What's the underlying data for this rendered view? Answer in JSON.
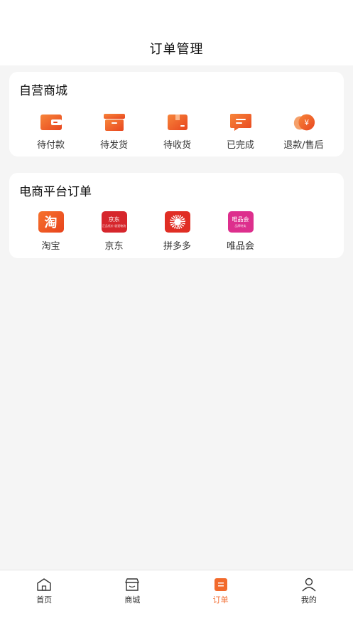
{
  "header": {
    "title": "订单管理"
  },
  "own_mall": {
    "title": "自营商城",
    "items": [
      {
        "label": "待付款",
        "icon": "wallet-icon"
      },
      {
        "label": "待发货",
        "icon": "box-icon"
      },
      {
        "label": "待收货",
        "icon": "package-icon"
      },
      {
        "label": "已完成",
        "icon": "message-icon"
      },
      {
        "label": "退款/售后",
        "icon": "refund-icon"
      }
    ]
  },
  "platform_orders": {
    "title": "电商平台订单",
    "items": [
      {
        "label": "淘宝",
        "logo_text": "淘"
      },
      {
        "label": "京东",
        "logo_text": "京东",
        "logo_sub": "正品低价 极速物流"
      },
      {
        "label": "拼多多"
      },
      {
        "label": "唯品会",
        "logo_text": "唯品会",
        "logo_sub": "品牌特卖"
      }
    ]
  },
  "tabbar": {
    "tabs": [
      {
        "label": "首页",
        "icon": "home-icon"
      },
      {
        "label": "商城",
        "icon": "store-icon"
      },
      {
        "label": "订单",
        "icon": "order-icon",
        "active": true
      },
      {
        "label": "我的",
        "icon": "user-icon"
      }
    ]
  },
  "colors": {
    "accent": "#f26a2c",
    "background": "#f5f5f5"
  }
}
